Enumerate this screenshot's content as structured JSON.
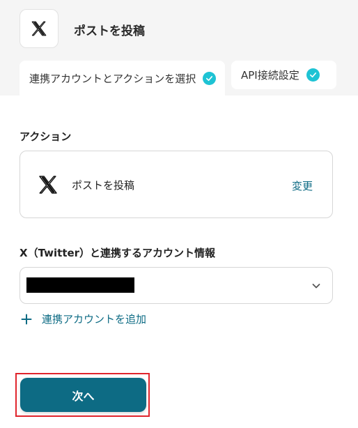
{
  "header": {
    "app_icon": "x-logo-icon",
    "title": "ポストを投稿"
  },
  "tabs": [
    {
      "label": "連携アカウントとアクションを選択",
      "completed": true,
      "active": true
    },
    {
      "label": "API接続設定",
      "completed": true,
      "active": false
    }
  ],
  "action_section": {
    "label": "アクション",
    "app_icon": "x-logo-icon",
    "action_name": "ポストを投稿",
    "change_label": "変更"
  },
  "account_section": {
    "label": "X（Twitter）と連携するアカウント情報",
    "selected_value_redacted": true,
    "add_account_label": "連携アカウントを追加"
  },
  "footer": {
    "next_label": "次へ"
  },
  "colors": {
    "accent": "#0d6b84",
    "check": "#1ec3d4",
    "highlight_border": "#e0242c",
    "header_bg": "#f5f5f5"
  }
}
